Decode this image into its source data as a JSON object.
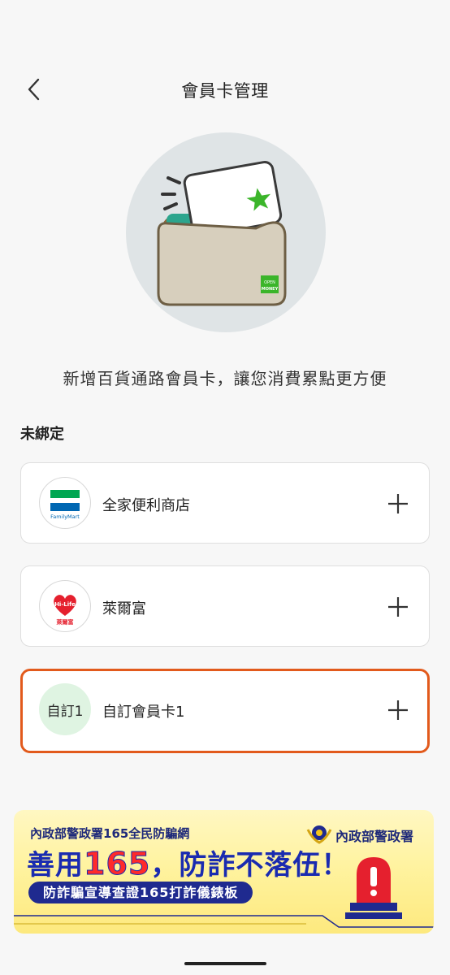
{
  "header": {
    "title": "會員卡管理"
  },
  "hero": {
    "subtitle": "新增百貨通路會員卡，讓您消費累點更方便"
  },
  "section": {
    "title": "未綁定"
  },
  "cards": [
    {
      "name": "全家便利商店",
      "logo_text": "FamilyMart"
    },
    {
      "name": "萊爾富",
      "logo_text": "Hi-Life",
      "logo_sub": "萊爾富"
    },
    {
      "name": "自訂會員卡1",
      "logo_text": "自訂1"
    }
  ],
  "wallet": {
    "brand": "MONEY",
    "brand_top": "OPEN"
  },
  "banner": {
    "top_line": "內政部警政署165全民防騙網",
    "org": "內政部警政署",
    "headline_pre": "善用",
    "headline_num": "165",
    "headline_post": "，防詐不落伍！",
    "pill": "防詐騙宣導查證165打詐儀錶板"
  },
  "colors": {
    "accent": "#e25a1c",
    "custom_logo_bg": "#dff4e2",
    "hero_bg": "#dfe4e6"
  }
}
